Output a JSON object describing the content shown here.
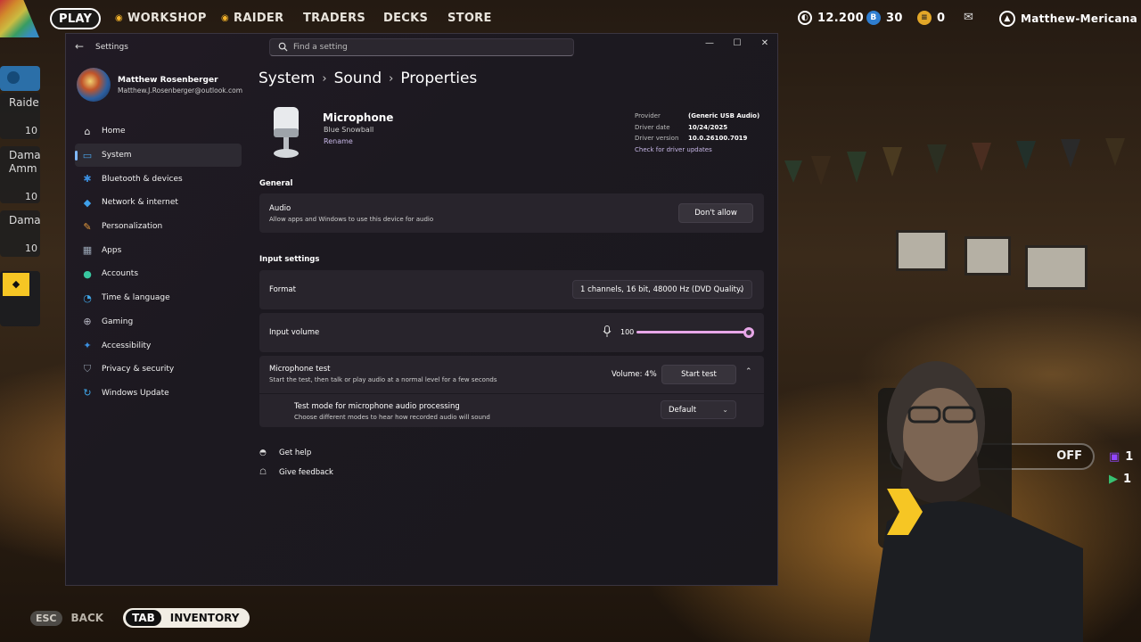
{
  "game": {
    "topbar": {
      "play": "PLAY",
      "nav": [
        "WORKSHOP",
        "RAIDER",
        "TRADERS",
        "DECKS",
        "STORE"
      ],
      "coins": "12.200",
      "tokens": "30",
      "cred": "0",
      "username": "Matthew-Mericana"
    },
    "left_cards": [
      {
        "title": "Raide",
        "count": "10"
      },
      {
        "title": "Dama\nAmm",
        "count": "10"
      },
      {
        "title": "Dama",
        "count": "10"
      }
    ],
    "bottom": {
      "esc_key": "ESC",
      "back_label": "BACK",
      "tab_key": "TAB",
      "inventory_label": "INVENTORY"
    },
    "overlay": {
      "off_label": "OFF",
      "stat1": "1",
      "stat2": "1"
    }
  },
  "settings": {
    "app_title": "Settings",
    "search_placeholder": "Find a setting",
    "profile": {
      "name": "Matthew Rosenberger",
      "email": "Matthew.J.Rosenberger@outlook.com"
    },
    "nav": [
      {
        "label": "Home",
        "icon": "home-icon",
        "color": "#e6e6e6"
      },
      {
        "label": "System",
        "icon": "system-icon",
        "color": "#4aa3e8",
        "active": true
      },
      {
        "label": "Bluetooth & devices",
        "icon": "bluetooth-icon",
        "color": "#3b8fe0"
      },
      {
        "label": "Network & internet",
        "icon": "network-icon",
        "color": "#3fa0ea"
      },
      {
        "label": "Personalization",
        "icon": "brush-icon",
        "color": "#e69a3c"
      },
      {
        "label": "Apps",
        "icon": "apps-icon",
        "color": "#9aa7b6"
      },
      {
        "label": "Accounts",
        "icon": "accounts-icon",
        "color": "#38c7a0"
      },
      {
        "label": "Time & language",
        "icon": "time-language-icon",
        "color": "#3fa6e8"
      },
      {
        "label": "Gaming",
        "icon": "gaming-icon",
        "color": "#b8b8c4"
      },
      {
        "label": "Accessibility",
        "icon": "accessibility-icon",
        "color": "#3b8fe0"
      },
      {
        "label": "Privacy & security",
        "icon": "shield-icon",
        "color": "#8f99a6"
      },
      {
        "label": "Windows Update",
        "icon": "update-icon",
        "color": "#3fa6e8"
      }
    ],
    "breadcrumb": [
      "System",
      "Sound",
      "Properties"
    ],
    "device": {
      "name": "Microphone",
      "model": "Blue Snowball",
      "rename": "Rename",
      "provider_label": "Provider",
      "provider_value": "(Generic USB Audio)",
      "driver_date_label": "Driver date",
      "driver_date_value": "10/24/2025",
      "driver_version_label": "Driver version",
      "driver_version_value": "10.0.26100.7019",
      "driver_update_link": "Check for driver updates"
    },
    "general": {
      "section": "General",
      "audio_title": "Audio",
      "audio_sub": "Allow apps and Windows to use this device for audio",
      "audio_button": "Don't allow"
    },
    "input": {
      "section": "Input settings",
      "format_label": "Format",
      "format_value": "1 channels, 16 bit, 48000 Hz (DVD Quality)",
      "volume_label": "Input volume",
      "volume_value": "100",
      "volume_level": 1.0,
      "mictest_title": "Microphone test",
      "mictest_sub": "Start the test, then talk or play audio at a normal level for a few seconds",
      "mictest_volume": "Volume: 4%",
      "mictest_button": "Start test",
      "testmode_title": "Test mode for microphone audio processing",
      "testmode_sub": "Choose different modes to hear how recorded audio will sound",
      "testmode_value": "Default"
    },
    "links": {
      "help": "Get help",
      "feedback": "Give feedback"
    },
    "accent": "#e7a7e8"
  }
}
